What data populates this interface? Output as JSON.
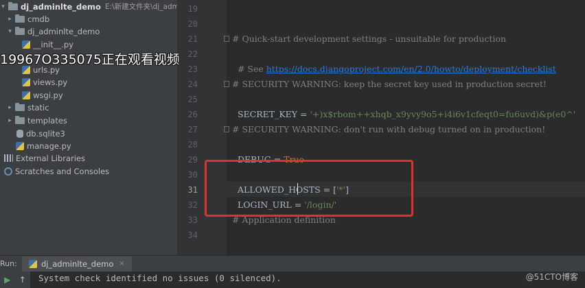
{
  "sidebar": {
    "root": {
      "name": "dj_adminlte_demo",
      "path": "E:\\新建文件夹\\dj_adminl"
    },
    "items": [
      {
        "label": "cmdb",
        "type": "folder"
      },
      {
        "label": "dj_adminlte_demo",
        "type": "folder"
      },
      {
        "label": "__init__.py",
        "type": "py"
      },
      {
        "label": "urls.py",
        "type": "py"
      },
      {
        "label": "views.py",
        "type": "py"
      },
      {
        "label": "wsgi.py",
        "type": "py"
      },
      {
        "label": "static",
        "type": "folder"
      },
      {
        "label": "templates",
        "type": "folder"
      },
      {
        "label": "db.sqlite3",
        "type": "db"
      },
      {
        "label": "manage.py",
        "type": "py"
      },
      {
        "label": "External Libraries",
        "type": "lib"
      },
      {
        "label": "Scratches and Consoles",
        "type": "scratch"
      }
    ]
  },
  "overlay": {
    "text": "19967O335075正在观看视频"
  },
  "editor": {
    "line_numbers": [
      "19",
      "20",
      "21",
      "22",
      "23",
      "24",
      "25",
      "26",
      "27",
      "28",
      "29",
      "30",
      "31",
      "32",
      "33",
      "34"
    ],
    "lines": {
      "l21": "# Quick-start development settings - unsuitable for production",
      "l22_prefix": "# See ",
      "l22_link": "https://docs.djangoproject.com/en/2.0/howto/deployment/checklist",
      "l24": "# SECURITY WARNING: keep the secret key used in production secret!",
      "l25_prefix": "SECRET_KEY = ",
      "l25_value": "'+)x$rbom++xhqb_x9yvy9o5+i4i6v1cfeqt0=fu6uvd)&p(e0^'",
      "l27": "# SECURITY WARNING: don't run with debug turned on in production!",
      "l28_prefix": "DEBUG = ",
      "l28_value": "True",
      "l30_prefix": "ALLOWED_HOSTS = [",
      "l30_value": "'*'",
      "l30_suffix": "]",
      "l31_prefix": "LOGIN_URL = ",
      "l31_value": "'/login/'",
      "l33": "# Application definition"
    }
  },
  "run": {
    "label": "Run:",
    "tab": "dj_adminlte_demo",
    "close": "×",
    "console_output": "System check identified no issues (0 silenced)."
  },
  "watermark": "@51CTO博客",
  "colors": {
    "highlight_box": "#e3302c",
    "accent_link": "#287bde"
  }
}
